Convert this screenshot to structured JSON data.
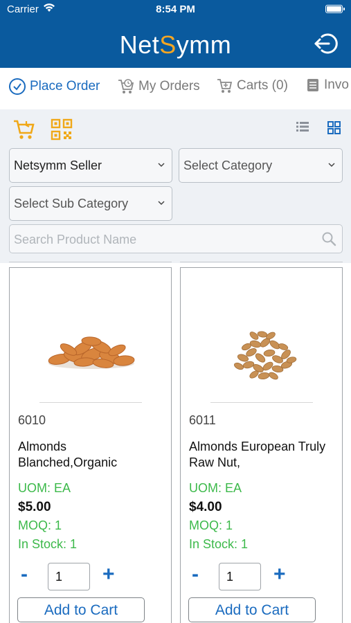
{
  "status": {
    "carrier": "Carrier",
    "time": "8:54 PM"
  },
  "header": {
    "logo_prefix": "Net",
    "logo_s": "S",
    "logo_suffix": "ymm"
  },
  "tabs": [
    {
      "label": "Place Order",
      "icon": "check-circle-icon"
    },
    {
      "label": "My Orders",
      "icon": "cart-clock-icon"
    },
    {
      "label": "Carts (0)",
      "icon": "cart-icon"
    },
    {
      "label": "Invo",
      "icon": "invoice-icon"
    }
  ],
  "filters": {
    "seller": "Netsymm Seller",
    "category": "Select Category",
    "sub_category": "Select Sub Category",
    "search_placeholder": "Search Product Name"
  },
  "colors": {
    "brand": "#0a5a9e",
    "accent": "#1a6bbf",
    "green": "#3cb94a",
    "logo_s": "#f5a623"
  },
  "products": [
    {
      "code": "6010",
      "name": "Almonds Blanched,Organic",
      "uom": "UOM: EA",
      "price": "$5.00",
      "moq": "MOQ: 1",
      "stock": "In Stock: 1",
      "qty": "1",
      "minus": "-",
      "plus": "+",
      "add_label": "Add to Cart"
    },
    {
      "code": "6011",
      "name": "Almonds European Truly Raw Nut,",
      "uom": "UOM: EA",
      "price": "$4.00",
      "moq": "MOQ: 1",
      "stock": "In Stock: 1",
      "qty": "1",
      "minus": "-",
      "plus": "+",
      "add_label": "Add to Cart"
    }
  ]
}
